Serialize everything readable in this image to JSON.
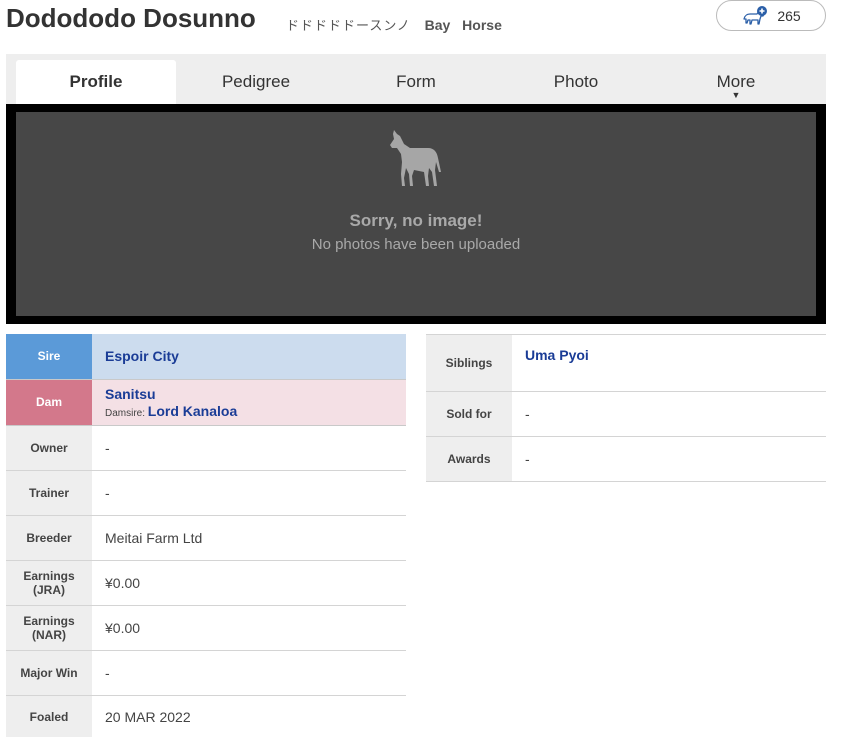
{
  "horse": {
    "name": "Dodododo Dosunno",
    "kana": "ドドドドドースンノ",
    "color": "Bay",
    "sex": "Horse"
  },
  "favorites": {
    "count": "265",
    "icon": "horse-add-icon"
  },
  "tabs": [
    {
      "label": "Profile",
      "active": true
    },
    {
      "label": "Pedigree",
      "active": false
    },
    {
      "label": "Form",
      "active": false
    },
    {
      "label": "Photo",
      "active": false
    },
    {
      "label": "More",
      "active": false
    }
  ],
  "photo": {
    "icon": "horse-silhouette-icon",
    "title": "Sorry, no image!",
    "message": "No photos have been uploaded"
  },
  "profile_left": {
    "sire": {
      "label": "Sire",
      "value": "Espoir City"
    },
    "dam": {
      "label": "Dam",
      "value": "Sanitsu",
      "damsire_label": "Damsire:",
      "damsire": "Lord Kanaloa"
    },
    "owner": {
      "label": "Owner",
      "value": "-"
    },
    "trainer": {
      "label": "Trainer",
      "value": "-"
    },
    "breeder": {
      "label": "Breeder",
      "value": "Meitai Farm Ltd"
    },
    "earnings_jra": {
      "label_1": "Earnings",
      "label_2": "(JRA)",
      "value": "¥0.00"
    },
    "earnings_nar": {
      "label_1": "Earnings",
      "label_2": "(NAR)",
      "value": "¥0.00"
    },
    "major_win": {
      "label": "Major Win",
      "value": "-"
    },
    "foaled": {
      "label": "Foaled",
      "value": "20 MAR 2022"
    }
  },
  "profile_right": {
    "siblings": {
      "label": "Siblings",
      "value": "Uma Pyoi"
    },
    "sold_for": {
      "label": "Sold for",
      "value": "-"
    },
    "awards": {
      "label": "Awards",
      "value": "-"
    }
  },
  "colors": {
    "sire_label": "#5b9ad8",
    "sire_value": "#ccdcee",
    "dam_label": "#d3788b",
    "dam_value": "#f4e0e5",
    "link": "#1a3c96"
  }
}
